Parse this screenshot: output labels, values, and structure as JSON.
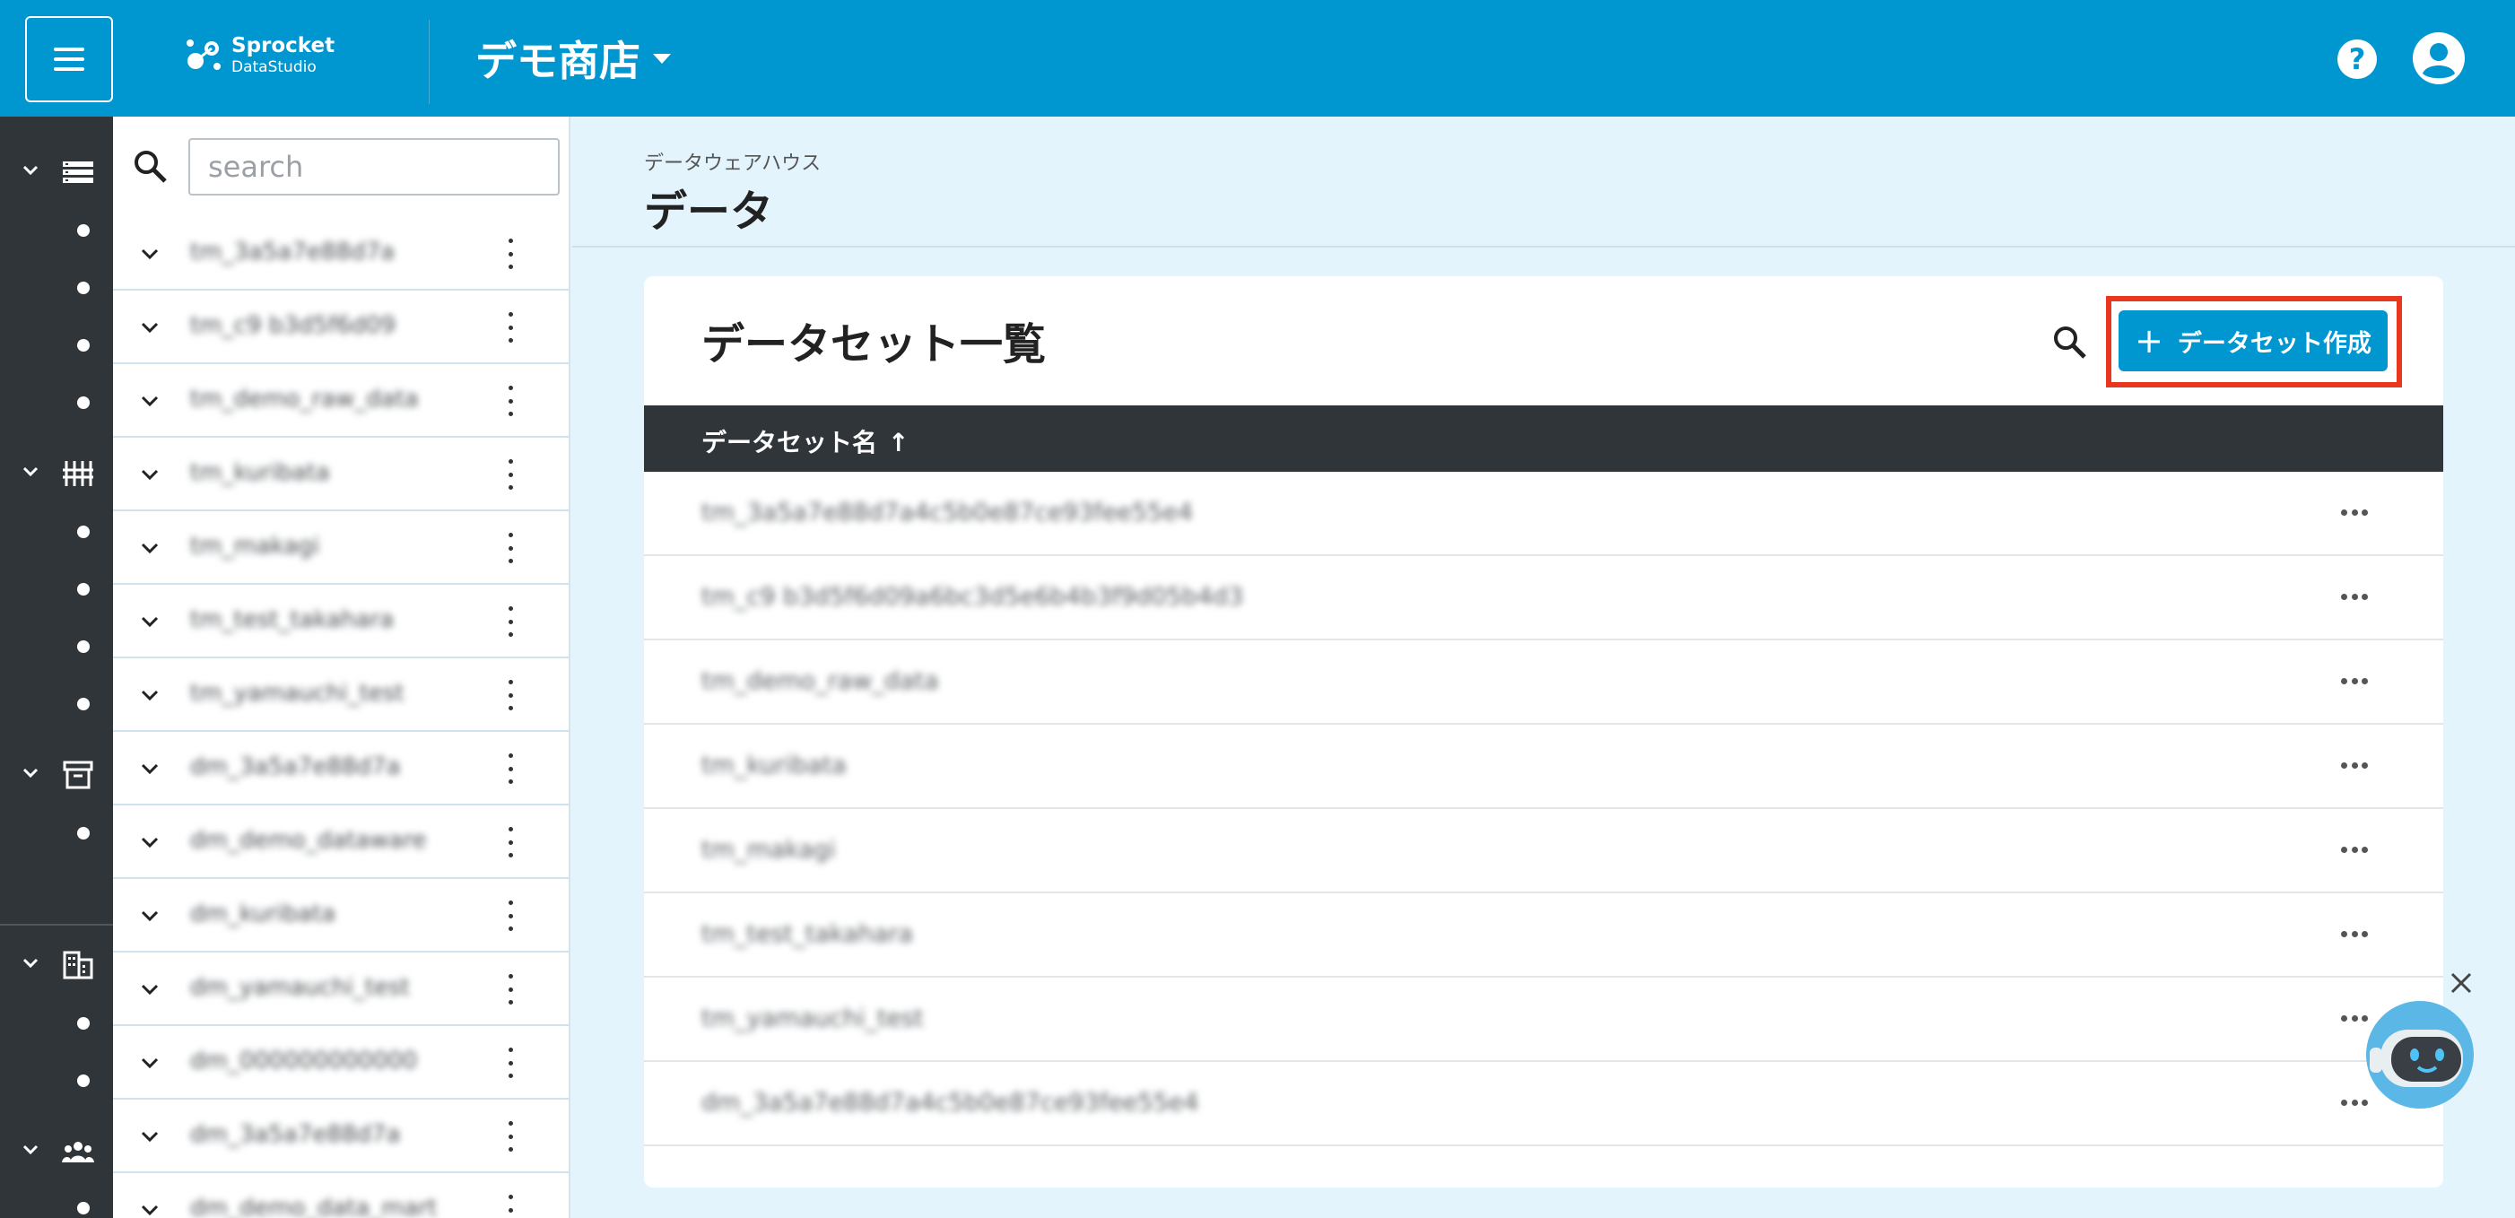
{
  "header": {
    "logo_name": "Sprocket",
    "logo_sub": "DataStudio",
    "store_name": "デモ商店",
    "help_label": "?"
  },
  "tree": {
    "search_placeholder": "search",
    "items": [
      {
        "label": "tm_3a5a7e88d7a"
      },
      {
        "label": "tm_c9 b3d5f6d09"
      },
      {
        "label": "tm_demo_raw_data"
      },
      {
        "label": "tm_kuribata"
      },
      {
        "label": "tm_makagi"
      },
      {
        "label": "tm_test_takahara"
      },
      {
        "label": "tm_yamauchi_test"
      },
      {
        "label": "dm_3a5a7e88d7a"
      },
      {
        "label": "dm_demo_dataware"
      },
      {
        "label": "dm_kuribata"
      },
      {
        "label": "dm_yamauchi_test"
      },
      {
        "label": "dm_000000000000"
      },
      {
        "label": "dm_3a5a7e88d7a"
      },
      {
        "label": "dm_demo_data_mart"
      }
    ]
  },
  "main": {
    "breadcrumb": "データウェアハウス",
    "title": "データ",
    "card_title": "データセット一覧",
    "create_button": "データセット作成",
    "create_plus": "+",
    "column_header": "データセット名",
    "sort_arrow": "↑",
    "rows": [
      {
        "name": "tm_3a5a7e88d7a4c5b0e87ce93fee55e4"
      },
      {
        "name": "tm_c9 b3d5f6d09a6bc3d5e6b4b3f9d05b4d3"
      },
      {
        "name": "tm_demo_raw_data"
      },
      {
        "name": "tm_kuribata"
      },
      {
        "name": "tm_makagi"
      },
      {
        "name": "tm_test_takahara"
      },
      {
        "name": "tm_yamauchi_test"
      },
      {
        "name": "dm_3a5a7e88d7a4c5b0e87ce93fee55e4"
      }
    ]
  },
  "colors": {
    "brand": "#0096cf",
    "rail": "#30353a",
    "highlight": "#e8371e"
  }
}
